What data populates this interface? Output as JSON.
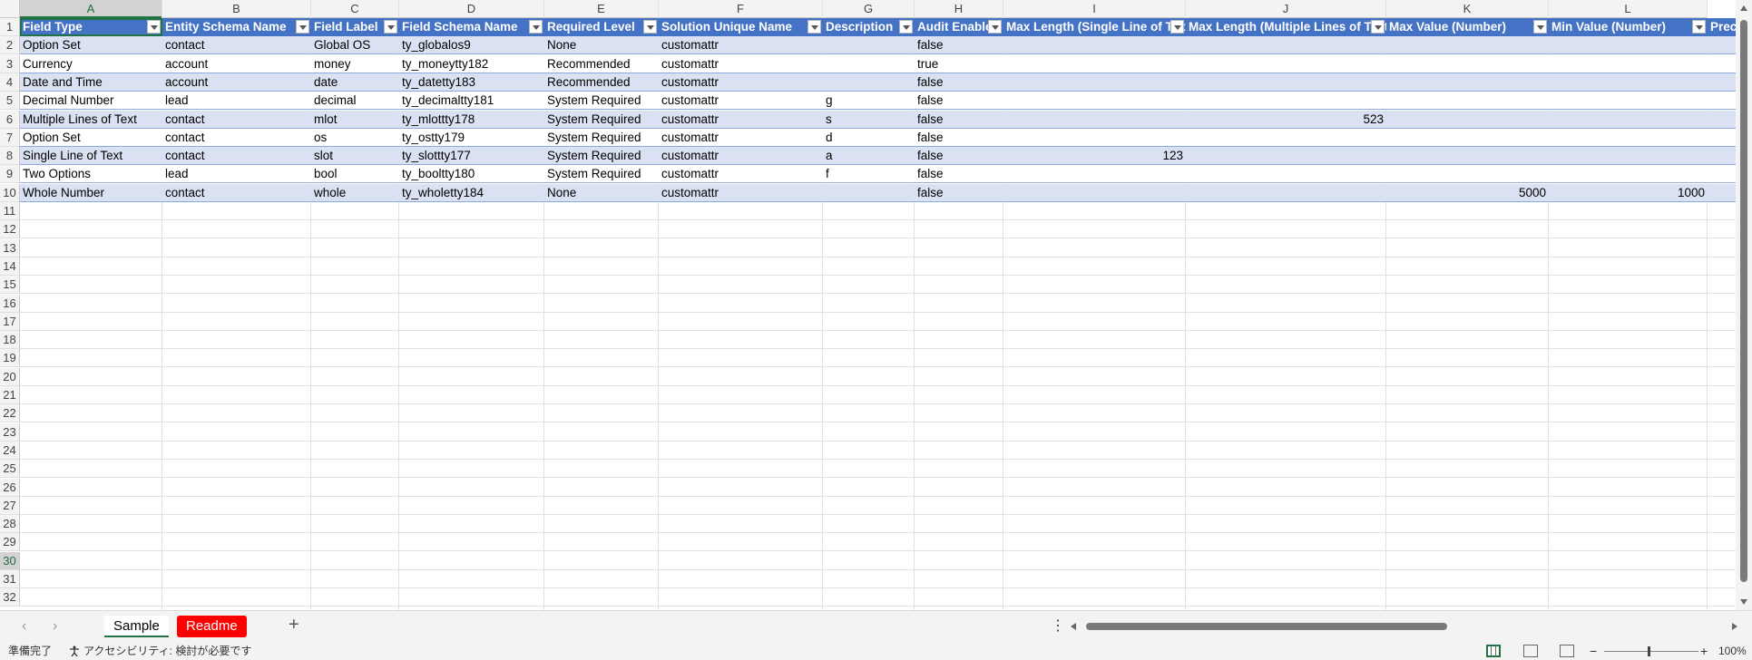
{
  "columns": [
    "A",
    "B",
    "C",
    "D",
    "E",
    "F",
    "G",
    "H",
    "I",
    "J",
    "K",
    "L"
  ],
  "headers": [
    "Field Type",
    "Entity Schema Name",
    "Field Label",
    "Field Schema Name",
    "Required Level",
    "Solution Unique Name",
    "Description",
    "Audit Enabled",
    "Max Length (Single Line of Text)",
    "Max Length (Multiple Lines of Text)",
    "Max Value (Number)",
    "Min Value (Number)",
    "Precision"
  ],
  "rows": [
    [
      "Option Set",
      "contact",
      "Global OS",
      "ty_globalos9",
      "None",
      "customattr",
      "",
      "false",
      "",
      "",
      "",
      ""
    ],
    [
      "Currency",
      "account",
      "money",
      "ty_moneytty182",
      "Recommended",
      "customattr",
      "",
      "true",
      "",
      "",
      "",
      ""
    ],
    [
      "Date and Time",
      "account",
      "date",
      "ty_datetty183",
      "Recommended",
      "customattr",
      "",
      "false",
      "",
      "",
      "",
      ""
    ],
    [
      "Decimal Number",
      "lead",
      "decimal",
      "ty_decimaltty181",
      "System Required",
      "customattr",
      "g",
      "false",
      "",
      "",
      "",
      ""
    ],
    [
      "Multiple Lines of Text",
      "contact",
      "mlot",
      "ty_mlottty178",
      "System Required",
      "customattr",
      "s",
      "false",
      "",
      "523",
      "",
      ""
    ],
    [
      "Option Set",
      "contact",
      "os",
      "ty_ostty179",
      "System Required",
      "customattr",
      "d",
      "false",
      "",
      "",
      "",
      ""
    ],
    [
      "Single Line of Text",
      "contact",
      "slot",
      "ty_slottty177",
      "System Required",
      "customattr",
      "a",
      "false",
      "123",
      "",
      "",
      ""
    ],
    [
      "Two Options",
      "lead",
      "bool",
      "ty_booltty180",
      "System Required",
      "customattr",
      "f",
      "false",
      "",
      "",
      "",
      ""
    ],
    [
      "Whole Number",
      "contact",
      "whole",
      "ty_wholetty184",
      "None",
      "customattr",
      "",
      "false",
      "",
      "",
      "5000",
      "1000"
    ]
  ],
  "row_numbers": [
    "1",
    "2",
    "3",
    "4",
    "5",
    "6",
    "7",
    "8",
    "9",
    "10",
    "11",
    "12",
    "13",
    "14",
    "15",
    "16",
    "17",
    "18",
    "19",
    "20",
    "21",
    "22",
    "23",
    "24",
    "25",
    "26",
    "27",
    "28",
    "29",
    "30",
    "31",
    "32"
  ],
  "selected_row_number": "30",
  "sheets": {
    "active": "Sample",
    "other": "Readme",
    "add": "+"
  },
  "status": {
    "ready": "準備完了",
    "accessibility": "アクセシビリティ: 検討が必要です",
    "zoom_minus": "−",
    "zoom_plus": "+",
    "zoom": "100%"
  },
  "colors": {
    "header_fill": "#4472c4",
    "band_fill": "#d9e1f2",
    "readme_tab": "#ff0000",
    "accent": "#217346"
  },
  "icons": [
    "filter-dropdown-icon",
    "add-sheet-icon",
    "accessibility-icon",
    "normal-view-icon",
    "page-layout-view-icon",
    "page-break-view-icon"
  ]
}
